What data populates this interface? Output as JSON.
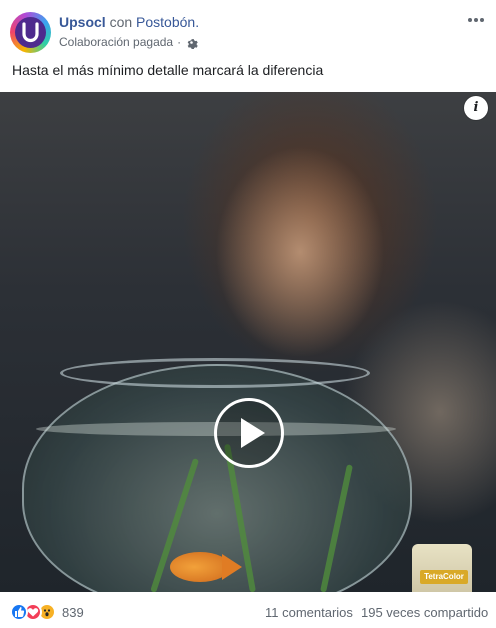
{
  "post": {
    "page_name": "Upsocl",
    "with_text": "con",
    "partner_name": "Postobón.",
    "sponsored_label": "Colaboración pagada",
    "separator": "·",
    "caption": "Hasta el más mínimo detalle marcará la diferencia"
  },
  "video": {
    "info_label": "i",
    "can_label": "TetraColor"
  },
  "footer": {
    "reaction_count": "839",
    "comments": "11 comentarios",
    "shares": "195 veces compartido"
  },
  "icons": {
    "avatar": "upsocl-logo-icon",
    "settings": "gear-icon",
    "more": "more-options-icon",
    "info": "info-icon",
    "play": "play-icon",
    "reactions": [
      "like-icon",
      "love-icon",
      "wow-icon"
    ]
  },
  "colors": {
    "link": "#385898",
    "secondary_text": "#606770",
    "like": "#1877f2",
    "love": "#f33e58",
    "wow": "#f7b125"
  }
}
